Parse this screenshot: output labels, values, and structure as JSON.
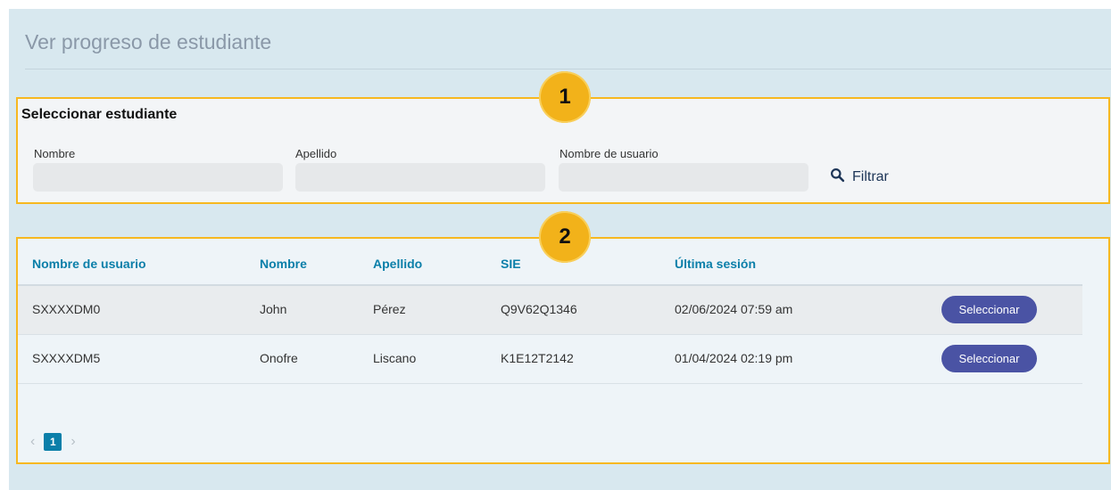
{
  "page": {
    "title": "Ver progreso de estudiante"
  },
  "filter": {
    "heading": "Seleccionar estudiante",
    "fields": [
      {
        "label": "Nombre",
        "value": ""
      },
      {
        "label": "Apellido",
        "value": ""
      },
      {
        "label": "Nombre de usuario",
        "value": ""
      }
    ],
    "button_label": "Filtrar",
    "button_icon": "search-icon"
  },
  "table": {
    "headers": [
      "Nombre de usuario",
      "Nombre",
      "Apellido",
      "SIE",
      "Última sesión"
    ],
    "rows": [
      {
        "username": "SXXXXDM0",
        "first_name": "John",
        "last_name": "Pérez",
        "sie": "Q9V62Q1346",
        "last_session": "02/06/2024 07:59 am",
        "action": "Seleccionar"
      },
      {
        "username": "SXXXXDM5",
        "first_name": "Onofre",
        "last_name": "Liscano",
        "sie": "K1E12T2142",
        "last_session": "01/04/2024 02:19 pm",
        "action": "Seleccionar"
      }
    ]
  },
  "pagination": {
    "current_page": "1",
    "prev_icon": "chevron-left-icon",
    "next_icon": "chevron-right-icon"
  },
  "annotations": {
    "badge_1": "1",
    "badge_2": "2"
  },
  "colors": {
    "accent": "#0b7fa9",
    "highlight_border": "#f7b820",
    "button": "#4a53a4",
    "background": "#d8e8ef"
  }
}
